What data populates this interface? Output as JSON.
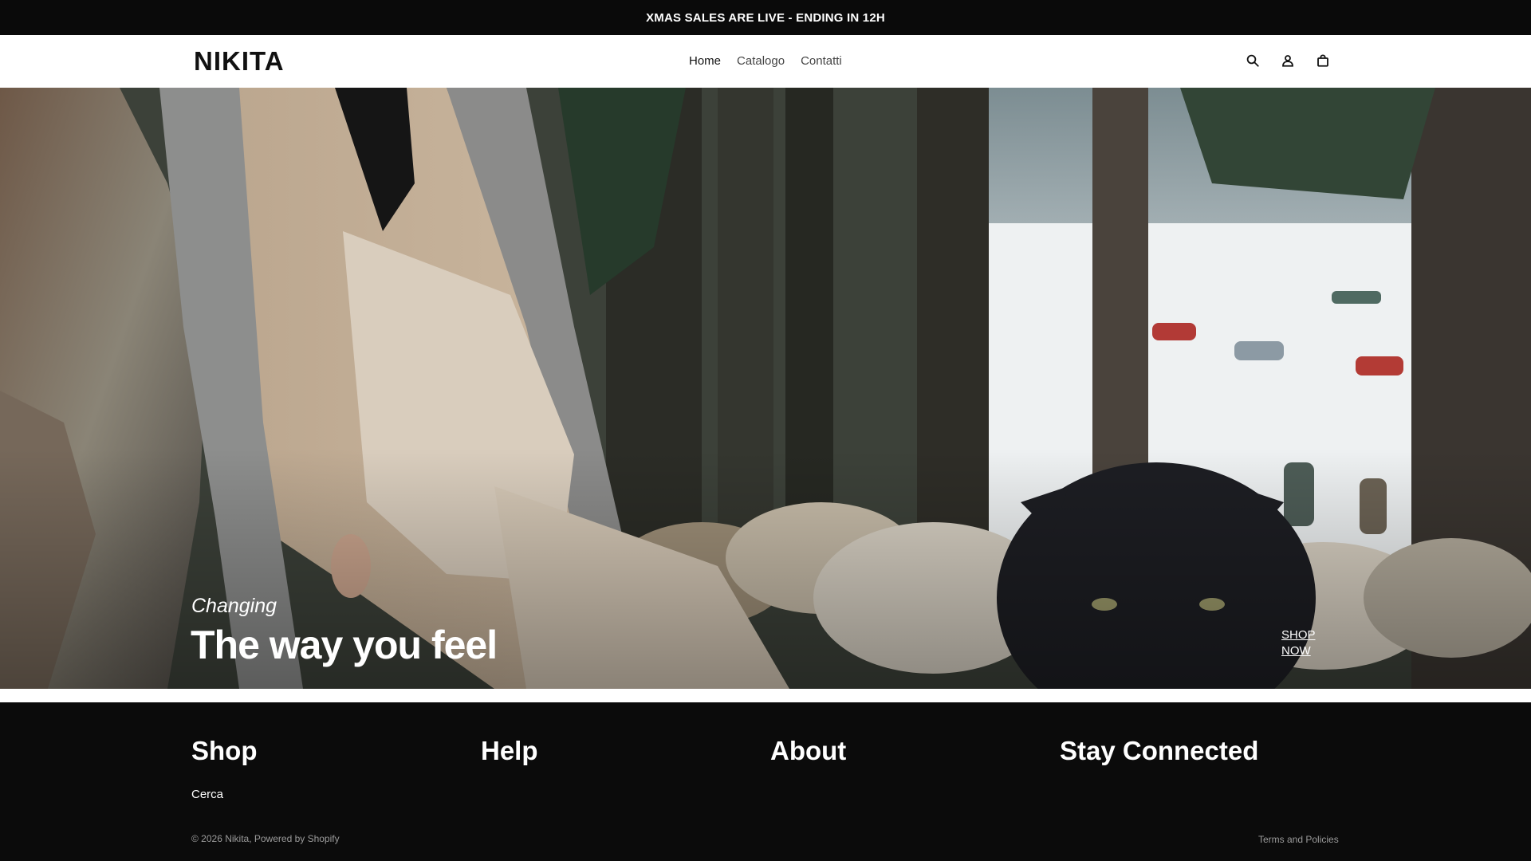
{
  "announcement": {
    "text": "XMAS SALES ARE LIVE - ENDING IN 12H"
  },
  "header": {
    "logo": "NIKITA",
    "nav": [
      {
        "label": "Home",
        "active": true
      },
      {
        "label": "Catalogo",
        "active": false
      },
      {
        "label": "Contatti",
        "active": false
      }
    ],
    "icons": [
      "search-icon",
      "account-icon",
      "cart-bag-icon"
    ]
  },
  "hero": {
    "subtitle": "Changing",
    "title": "The way you feel",
    "cta": "SHOP NOW"
  },
  "footer": {
    "columns": [
      "Shop",
      "Help",
      "About",
      "Stay Connected"
    ],
    "shop_links": [
      "Cerca"
    ],
    "copyright": "© 2026 Nikita, Powered by Shopify",
    "terms": "Terms and Policies"
  },
  "colors": {
    "announcement_bg": "#0a0a0a",
    "footer_bg": "#0b0b0b",
    "text_light": "#ffffff"
  }
}
